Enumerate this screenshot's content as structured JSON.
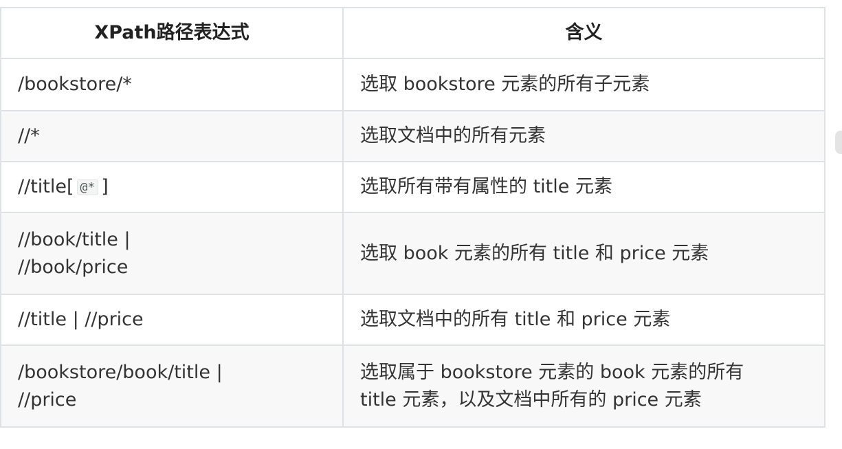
{
  "table": {
    "headers": [
      "XPath路径表达式",
      "含义"
    ],
    "rows": [
      {
        "path": "/bookstore/*",
        "meaning": "选取 bookstore 元素的所有子元素"
      },
      {
        "path": "//*",
        "meaning": "选取文档中的所有元素"
      },
      {
        "path_prefix": "//title[",
        "path_code": "@*",
        "path_suffix": "]",
        "meaning": "选取所有带有属性的 title 元素"
      },
      {
        "path_line1": "//book/title |",
        "path_line2": "//book/price",
        "meaning": "选取 book 元素的所有 title 和 price 元素"
      },
      {
        "path": "//title | //price",
        "meaning": "选取文档中的所有 title 和 price 元素"
      },
      {
        "path_line1": "/bookstore/book/title |",
        "path_line2": "//price",
        "meaning_line1": "选取属于 bookstore 元素的 book 元素的所有",
        "meaning_line2": "title 元素，以及文档中所有的 price 元素"
      }
    ]
  }
}
